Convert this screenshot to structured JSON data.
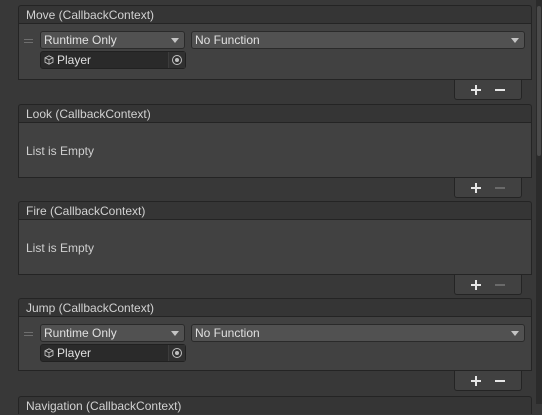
{
  "events": [
    {
      "title": "Move (CallbackContext)",
      "listeners": [
        {
          "mode": "Runtime Only",
          "function": "No Function",
          "target": "Player",
          "target_icon": "game-object-icon"
        }
      ],
      "empty_text": ""
    },
    {
      "title": "Look (CallbackContext)",
      "listeners": [],
      "empty_text": "List is Empty"
    },
    {
      "title": "Fire (CallbackContext)",
      "listeners": [],
      "empty_text": "List is Empty"
    },
    {
      "title": "Jump (CallbackContext)",
      "listeners": [
        {
          "mode": "Runtime Only",
          "function": "No Function",
          "target": "Player",
          "target_icon": "game-object-icon"
        }
      ],
      "empty_text": ""
    },
    {
      "title": "Navigation (CallbackContext)",
      "listeners": [],
      "empty_text": ""
    }
  ],
  "buttons": {
    "add": "add-listener (+)",
    "remove": "remove-listener (−)"
  }
}
